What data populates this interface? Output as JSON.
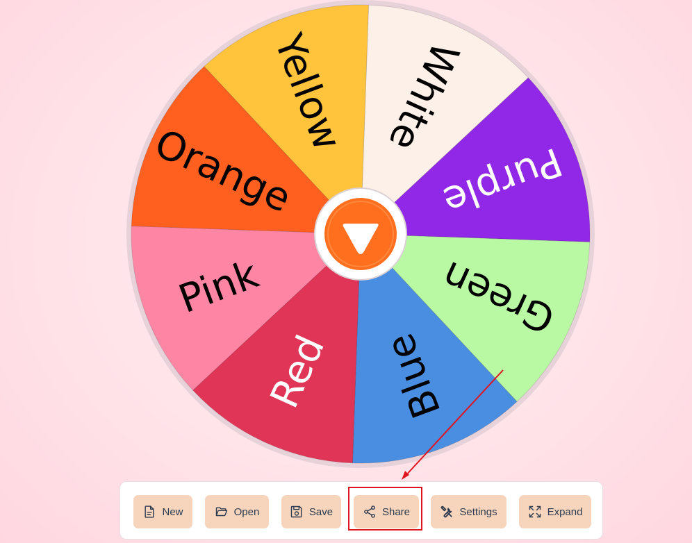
{
  "wheel": {
    "segments": [
      {
        "label": "White",
        "color": "#fcf0e8",
        "text_color": "#000000"
      },
      {
        "label": "Purple",
        "color": "#9128e8",
        "text_color": "#ffffff"
      },
      {
        "label": "Green",
        "color": "#baf9a4",
        "text_color": "#000000"
      },
      {
        "label": "Blue",
        "color": "#4a8ee2",
        "text_color": "#000000"
      },
      {
        "label": "Red",
        "color": "#e03556",
        "text_color": "#ffffff"
      },
      {
        "label": "Pink",
        "color": "#ff85a5",
        "text_color": "#000000"
      },
      {
        "label": "Orange",
        "color": "#ff6020",
        "text_color": "#000000"
      },
      {
        "label": "Yellow",
        "color": "#ffc43c",
        "text_color": "#000000"
      }
    ],
    "rim_color": "#e8d2da",
    "spin_button_color": "#ff6f1e"
  },
  "toolbar": {
    "new_label": "New",
    "open_label": "Open",
    "save_label": "Save",
    "share_label": "Share",
    "settings_label": "Settings",
    "expand_label": "Expand"
  },
  "annotation": {
    "highlight_color": "#e0141e"
  }
}
